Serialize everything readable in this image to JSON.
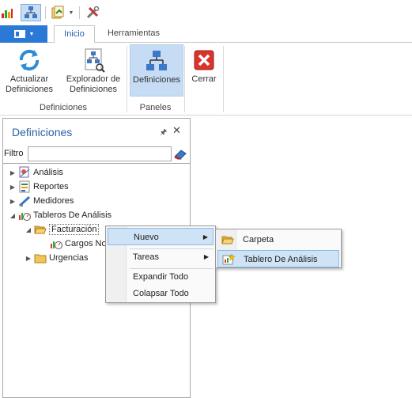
{
  "quick_access": {
    "icons": [
      "chart-bars-icon",
      "org-chart-icon",
      "report-export-icon",
      "dropdown-icon",
      "tools-icon"
    ]
  },
  "ribbon": {
    "tabs": [
      "Inicio",
      "Herramientas"
    ],
    "active_tab": "Inicio",
    "buttons": {
      "actualizar": "Actualizar Definiciones",
      "explorador": "Explorador de Definiciones",
      "definiciones": "Definiciones",
      "cerrar": "Cerrar"
    },
    "groups": {
      "definiciones": "Definiciones",
      "paneles": "Paneles"
    }
  },
  "panel": {
    "title": "Definiciones",
    "filter_label": "Filtro",
    "filter_value": "",
    "tree": [
      {
        "label": "Análisis",
        "icon": "analysis-icon"
      },
      {
        "label": "Reportes",
        "icon": "report-icon"
      },
      {
        "label": "Medidores",
        "icon": "gauge-icon"
      },
      {
        "label": "Tableros De Análisis",
        "icon": "dashboard-icon"
      },
      {
        "label": "Facturación",
        "icon": "folder-open-icon"
      },
      {
        "label": "Cargos No",
        "icon": "dashboard-icon"
      },
      {
        "label": "Urgencias",
        "icon": "folder-icon"
      }
    ]
  },
  "context_menu": {
    "items": [
      "Nuevo",
      "Tareas",
      "Expandir Todo",
      "Colapsar Todo"
    ],
    "highlighted": "Nuevo"
  },
  "submenu": {
    "items": [
      "Carpeta",
      "Tablero De Análisis"
    ],
    "highlighted": "Tablero De Análisis"
  },
  "colors": {
    "accent": "#2b79d6",
    "title_blue": "#2b5fa8",
    "highlight": "#cfe3f7"
  }
}
